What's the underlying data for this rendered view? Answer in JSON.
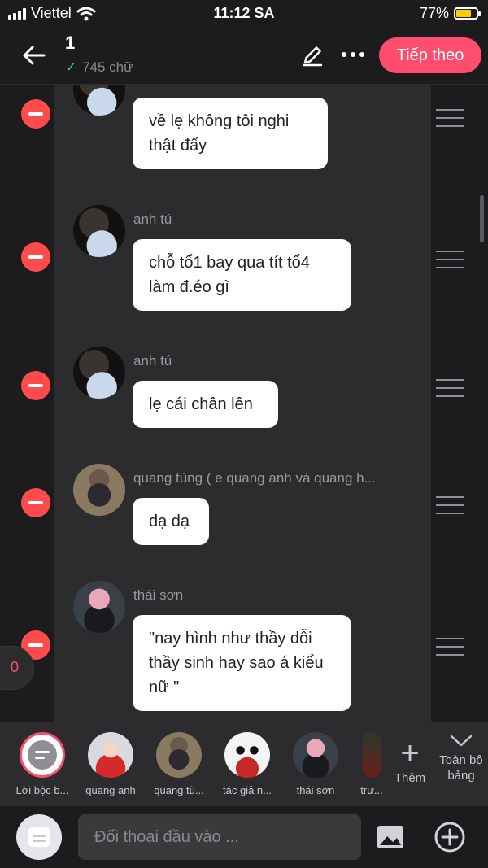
{
  "status": {
    "carrier": "Viettel",
    "time": "11:12 SA",
    "battery": "77%"
  },
  "header": {
    "title": "1",
    "word_count": "745 chữ",
    "next_label": "Tiếp theo"
  },
  "messages": [
    {
      "name": "",
      "text": "về lẹ không tôi nghi thật đấy"
    },
    {
      "name": "anh tú",
      "text": "chỗ tổ1 bay qua tít tổ4 làm đ.éo gì"
    },
    {
      "name": "anh tú",
      "text": "lẹ cái chân lên"
    },
    {
      "name": "quang tùng ( e quang anh và quang h...",
      "text": "dạ dạ"
    },
    {
      "name": "thái sơn",
      "text": "\"nay hình như thầy dỗi thầy sinh hay sao á kiểu nữ \""
    }
  ],
  "unread_badge": "0",
  "characters": [
    {
      "label": "Lời bộc b..."
    },
    {
      "label": "quang anh"
    },
    {
      "label": "quang tù..."
    },
    {
      "label": "tác giả n..."
    },
    {
      "label": "thái sơn"
    },
    {
      "label": "trư..."
    }
  ],
  "char_actions": {
    "add_label": "Thêm",
    "all_label": "Toàn bộ bảng"
  },
  "composer": {
    "placeholder": "Đối thoại đầu vào ..."
  },
  "colors": {
    "accent": "#ff4d6d",
    "remove": "#ff4b4b",
    "check": "#2ecc71"
  }
}
